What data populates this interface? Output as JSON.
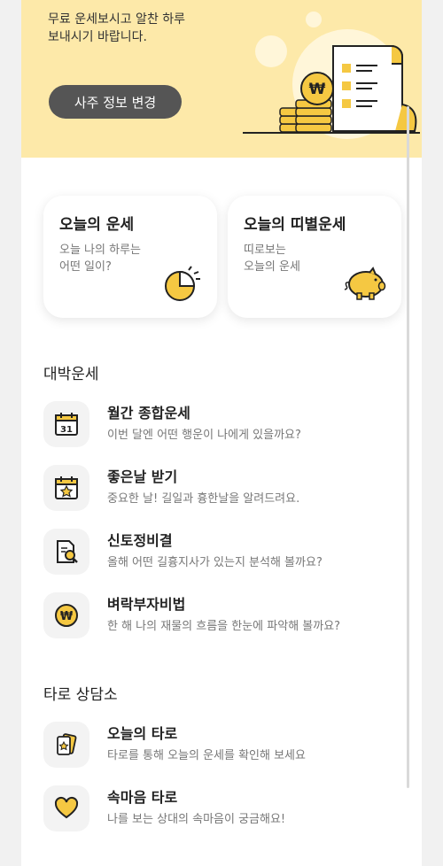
{
  "banner": {
    "lines": [
      "무료 운세보시고 알찬 하루",
      "보내시기 바랍니다."
    ],
    "button_label": "사주 정보 변경",
    "coin_symbol": "₩"
  },
  "cards": [
    {
      "title": "오늘의 운세",
      "desc": [
        "오늘 나의 하루는",
        "어떤 일이?"
      ],
      "icon": "pie-chart-icon"
    },
    {
      "title": "오늘의 띠별운세",
      "desc": [
        "띠로보는",
        "오늘의 운세"
      ],
      "icon": "pig-icon"
    }
  ],
  "sections": [
    {
      "title": "대박운세",
      "items": [
        {
          "title": "월간 종합운세",
          "sub": "이번 달엔 어떤 행운이 나에게 있을까요?",
          "icon": "calendar-icon",
          "icon_text": "31"
        },
        {
          "title": "좋은날 받기",
          "sub": "중요한 날! 길일과 흉한날을 알려드려요.",
          "icon": "calendar-star-icon"
        },
        {
          "title": "신토정비결",
          "sub": "올해 어떤 길흉지사가 있는지 분석해 볼까요?",
          "icon": "document-search-icon"
        },
        {
          "title": "벼락부자비법",
          "sub": "한 해 나의 재물의 흐름을 한눈에 파악해 볼까요?",
          "icon": "won-coin-icon",
          "icon_text": "₩"
        }
      ]
    },
    {
      "title": "타로 상담소",
      "items": [
        {
          "title": "오늘의 타로",
          "sub": "타로를 통해 오늘의 운세를 확인해 보세요",
          "icon": "tarot-card-icon"
        },
        {
          "title": "속마음 타로",
          "sub": "나를 보는 상대의 속마음이 궁금해요!",
          "icon": "heart-icon"
        }
      ]
    }
  ],
  "colors": {
    "accent": "#f5c842",
    "banner_bg": "#fde9a9",
    "button_bg": "#555555"
  }
}
